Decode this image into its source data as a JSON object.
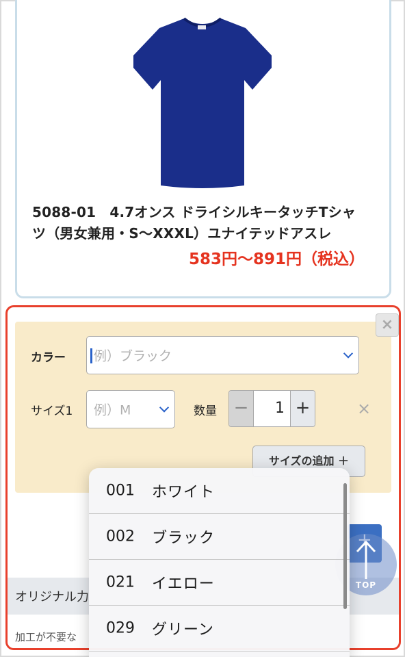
{
  "product": {
    "name_line1": "5088-01　4.7オンス ドライシルキータッチTシャ",
    "name_line2": "ツ（男女兼用・S〜XXXL）ユナイテッドアスレ",
    "price": "583円〜891円（税込）",
    "shirt_color": "#1a2e8a"
  },
  "order_form": {
    "close_label": "×",
    "color_label": "カラー",
    "color_placeholder": "例）ブラック",
    "size_label": "サイズ1",
    "size_placeholder": "例）M",
    "quantity_label": "数量",
    "quantity_value": "1",
    "minus_label": "−",
    "plus_label": "+",
    "remove_label": "×",
    "add_size_label": "サイズの追加 ＋"
  },
  "section": {
    "band_text": "オリジナル力",
    "note_text": "加工が不要な"
  },
  "top_button": {
    "label": "TOP"
  },
  "color_dropdown": {
    "options": [
      {
        "code": "001",
        "name": "ホワイト"
      },
      {
        "code": "002",
        "name": "ブラック"
      },
      {
        "code": "021",
        "name": "イエロー"
      },
      {
        "code": "029",
        "name": "グリーン"
      }
    ]
  },
  "colors": {
    "price": "#e5331f",
    "highlight": "#e8402c",
    "panel_bg": "#f9ebca",
    "accent_blue": "#2a62c9"
  }
}
